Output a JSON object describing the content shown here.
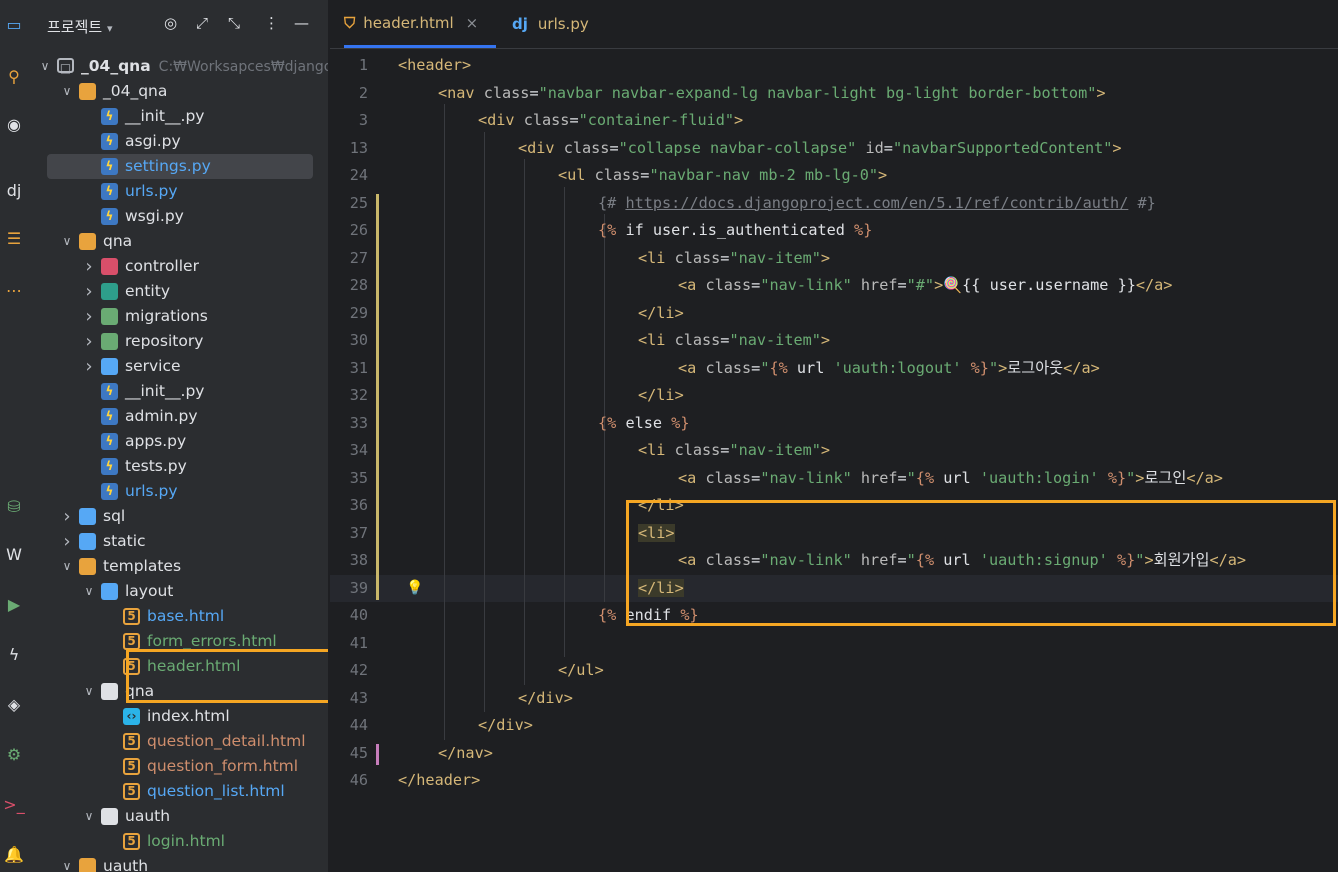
{
  "activity_bar": {
    "icons": [
      "monitor-icon",
      "commit-icon",
      "github-icon",
      "django-icon",
      "structure-icon",
      "more-icon",
      "database-icon",
      "word-icon",
      "run-icon",
      "python-icon",
      "layers-icon",
      "settings-icon",
      "terminal-icon",
      "notifications-icon"
    ]
  },
  "project_panel": {
    "title": "프로젝트",
    "tree": [
      {
        "label": "_04_qna",
        "hint": "C:₩Worksapces₩django",
        "kind": "root",
        "expanded": true,
        "depth": 0
      },
      {
        "label": "_04_qna",
        "kind": "folder",
        "expanded": true,
        "depth": 1
      },
      {
        "label": "__init__.py",
        "kind": "python",
        "depth": 2
      },
      {
        "label": "asgi.py",
        "kind": "python",
        "depth": 2
      },
      {
        "label": "settings.py",
        "kind": "python",
        "depth": 2,
        "selected": true,
        "color": "#56a8f5"
      },
      {
        "label": "urls.py",
        "kind": "python",
        "depth": 2,
        "color": "#56a8f5"
      },
      {
        "label": "wsgi.py",
        "kind": "python",
        "depth": 2
      },
      {
        "label": "qna",
        "kind": "folder",
        "expanded": true,
        "depth": 1
      },
      {
        "label": "controller",
        "kind": "pkg-controller",
        "expanded": false,
        "depth": 2
      },
      {
        "label": "entity",
        "kind": "pkg-entity",
        "expanded": false,
        "depth": 2
      },
      {
        "label": "migrations",
        "kind": "pkg-db",
        "expanded": false,
        "depth": 2
      },
      {
        "label": "repository",
        "kind": "pkg-db",
        "expanded": false,
        "depth": 2
      },
      {
        "label": "service",
        "kind": "pkg-service",
        "expanded": false,
        "depth": 2
      },
      {
        "label": "__init__.py",
        "kind": "python",
        "depth": 2
      },
      {
        "label": "admin.py",
        "kind": "python",
        "depth": 2
      },
      {
        "label": "apps.py",
        "kind": "python",
        "depth": 2
      },
      {
        "label": "tests.py",
        "kind": "python",
        "depth": 2
      },
      {
        "label": "urls.py",
        "kind": "python",
        "depth": 2,
        "color": "#56a8f5"
      },
      {
        "label": "sql",
        "kind": "folder-sql",
        "expanded": false,
        "depth": 1
      },
      {
        "label": "static",
        "kind": "folder-web",
        "expanded": false,
        "depth": 1
      },
      {
        "label": "templates",
        "kind": "folder-tpl",
        "expanded": true,
        "depth": 1
      },
      {
        "label": "layout",
        "kind": "folder-layout",
        "expanded": true,
        "depth": 2
      },
      {
        "label": "base.html",
        "kind": "html",
        "depth": 3,
        "color": "#56a8f5"
      },
      {
        "label": "form_errors.html",
        "kind": "html",
        "depth": 3,
        "color": "#6aab73"
      },
      {
        "label": "header.html",
        "kind": "html",
        "depth": 3,
        "color": "#6aab73"
      },
      {
        "label": "qna",
        "kind": "folder-plain",
        "expanded": true,
        "depth": 2
      },
      {
        "label": "index.html",
        "kind": "html-blue",
        "depth": 3
      },
      {
        "label": "question_detail.html",
        "kind": "html",
        "depth": 3,
        "color": "#cf8e6d"
      },
      {
        "label": "question_form.html",
        "kind": "html",
        "depth": 3,
        "color": "#cf8e6d"
      },
      {
        "label": "question_list.html",
        "kind": "html",
        "depth": 3,
        "color": "#56a8f5"
      },
      {
        "label": "uauth",
        "kind": "folder-plain",
        "expanded": true,
        "depth": 2
      },
      {
        "label": "login.html",
        "kind": "html",
        "depth": 3,
        "color": "#6aab73"
      },
      {
        "label": "uauth",
        "kind": "folder",
        "expanded": true,
        "depth": 1
      }
    ]
  },
  "tabs": [
    {
      "label": "header.html",
      "active": true,
      "icon": "html5-icon",
      "close": "×"
    },
    {
      "label": "urls.py",
      "active": false,
      "icon": "django-icon",
      "icon_text": "dj"
    }
  ],
  "editor": {
    "lines": [
      {
        "n": "1",
        "indent": 0,
        "segs": [
          [
            "tg",
            "<header>"
          ]
        ]
      },
      {
        "n": "2",
        "indent": 1,
        "segs": [
          [
            "tg",
            "<nav "
          ],
          [
            "at",
            "class"
          ],
          [
            "tx",
            "="
          ],
          [
            "av",
            "\"navbar navbar-expand-lg navbar-light bg-light border-bottom\""
          ],
          [
            "tg",
            ">"
          ]
        ]
      },
      {
        "n": "3",
        "indent": 2,
        "segs": [
          [
            "tg",
            "<div "
          ],
          [
            "at",
            "class"
          ],
          [
            "tx",
            "="
          ],
          [
            "av",
            "\"container-fluid\""
          ],
          [
            "tg",
            ">"
          ]
        ]
      },
      {
        "n": "13",
        "indent": 3,
        "segs": [
          [
            "tg",
            "<div "
          ],
          [
            "at",
            "class"
          ],
          [
            "tx",
            "="
          ],
          [
            "av",
            "\"collapse navbar-collapse\""
          ],
          [
            "tx",
            " "
          ],
          [
            "at",
            "id"
          ],
          [
            "tx",
            "="
          ],
          [
            "av",
            "\"navbarSupportedContent\""
          ],
          [
            "tg",
            ">"
          ]
        ]
      },
      {
        "n": "24",
        "indent": 4,
        "segs": [
          [
            "tg",
            "<ul "
          ],
          [
            "at",
            "class"
          ],
          [
            "tx",
            "="
          ],
          [
            "av",
            "\"navbar-nav mb-2 mb-lg-0\""
          ],
          [
            "tg",
            ">"
          ]
        ]
      },
      {
        "n": "25",
        "indent": 5,
        "segs": [
          [
            "cm",
            "{# https://docs.djangoproject.com/en/5.1/ref/contrib/auth/ #}"
          ]
        ]
      },
      {
        "n": "26",
        "indent": 5,
        "segs": [
          [
            "tp",
            "{%"
          ],
          [
            "tx",
            " if user.is_authenticated "
          ],
          [
            "tp",
            "%}"
          ]
        ]
      },
      {
        "n": "27",
        "indent": 6,
        "segs": [
          [
            "tg",
            "<li "
          ],
          [
            "at",
            "class"
          ],
          [
            "tx",
            "="
          ],
          [
            "av",
            "\"nav-item\""
          ],
          [
            "tg",
            ">"
          ]
        ]
      },
      {
        "n": "28",
        "indent": 7,
        "segs": [
          [
            "tg",
            "<a "
          ],
          [
            "at",
            "class"
          ],
          [
            "tx",
            "="
          ],
          [
            "av",
            "\"nav-link\""
          ],
          [
            "tx",
            " "
          ],
          [
            "at",
            "href"
          ],
          [
            "tx",
            "="
          ],
          [
            "av",
            "\"#\""
          ],
          [
            "tg",
            ">"
          ],
          [
            "tx",
            "🍭{{ user.username }}"
          ],
          [
            "tg",
            "</a>"
          ]
        ]
      },
      {
        "n": "29",
        "indent": 6,
        "segs": [
          [
            "tg",
            "</li>"
          ]
        ]
      },
      {
        "n": "30",
        "indent": 6,
        "segs": [
          [
            "tg",
            "<li "
          ],
          [
            "at",
            "class"
          ],
          [
            "tx",
            "="
          ],
          [
            "av",
            "\"nav-item\""
          ],
          [
            "tg",
            ">"
          ]
        ]
      },
      {
        "n": "31",
        "indent": 7,
        "segs": [
          [
            "tg",
            "<a "
          ],
          [
            "at",
            "class"
          ],
          [
            "tx",
            "="
          ],
          [
            "av",
            "\""
          ],
          [
            "tp",
            "{%"
          ],
          [
            "tx",
            " url "
          ],
          [
            "av",
            "'uauth:logout'"
          ],
          [
            "tx",
            " "
          ],
          [
            "tp",
            "%}"
          ],
          [
            "av",
            "\""
          ],
          [
            "tg",
            ">"
          ],
          [
            "tx",
            "로그아웃"
          ],
          [
            "tg",
            "</a>"
          ]
        ]
      },
      {
        "n": "32",
        "indent": 6,
        "segs": [
          [
            "tg",
            "</li>"
          ]
        ]
      },
      {
        "n": "33",
        "indent": 5,
        "segs": [
          [
            "tp",
            "{%"
          ],
          [
            "tx",
            " else "
          ],
          [
            "tp",
            "%}"
          ]
        ]
      },
      {
        "n": "34",
        "indent": 6,
        "segs": [
          [
            "tg",
            "<li "
          ],
          [
            "at",
            "class"
          ],
          [
            "tx",
            "="
          ],
          [
            "av",
            "\"nav-item\""
          ],
          [
            "tg",
            ">"
          ]
        ]
      },
      {
        "n": "35",
        "indent": 7,
        "segs": [
          [
            "tg",
            "<a "
          ],
          [
            "at",
            "class"
          ],
          [
            "tx",
            "="
          ],
          [
            "av",
            "\"nav-link\""
          ],
          [
            "tx",
            " "
          ],
          [
            "at",
            "href"
          ],
          [
            "tx",
            "="
          ],
          [
            "av",
            "\""
          ],
          [
            "tp",
            "{%"
          ],
          [
            "tx",
            " url "
          ],
          [
            "av",
            "'uauth:login'"
          ],
          [
            "tx",
            " "
          ],
          [
            "tp",
            "%}"
          ],
          [
            "av",
            "\""
          ],
          [
            "tg",
            ">"
          ],
          [
            "tx",
            "로그인"
          ],
          [
            "tg",
            "</a>"
          ]
        ]
      },
      {
        "n": "36",
        "indent": 6,
        "segs": [
          [
            "tg",
            "</li>"
          ]
        ]
      },
      {
        "n": "37",
        "indent": 6,
        "segs": [
          [
            "tgb",
            "<li>"
          ]
        ]
      },
      {
        "n": "38",
        "indent": 7,
        "segs": [
          [
            "tg",
            "<a "
          ],
          [
            "at",
            "class"
          ],
          [
            "tx",
            "="
          ],
          [
            "av",
            "\"nav-link\""
          ],
          [
            "tx",
            " "
          ],
          [
            "at",
            "href"
          ],
          [
            "tx",
            "="
          ],
          [
            "av",
            "\""
          ],
          [
            "tp",
            "{%"
          ],
          [
            "tx",
            " url "
          ],
          [
            "av",
            "'uauth:signup'"
          ],
          [
            "tx",
            " "
          ],
          [
            "tp",
            "%}"
          ],
          [
            "av",
            "\""
          ],
          [
            "tg",
            ">"
          ],
          [
            "tx",
            "회원가입"
          ],
          [
            "tg",
            "</a>"
          ]
        ]
      },
      {
        "n": "39",
        "indent": 6,
        "segs": [
          [
            "tgb",
            "</li>"
          ]
        ],
        "current": true
      },
      {
        "n": "40",
        "indent": 5,
        "segs": [
          [
            "tp",
            "{%"
          ],
          [
            "tx",
            " endif "
          ],
          [
            "tp",
            "%}"
          ]
        ]
      },
      {
        "n": "41",
        "indent": 0,
        "segs": []
      },
      {
        "n": "42",
        "indent": 4,
        "segs": [
          [
            "tg",
            "</ul>"
          ]
        ]
      },
      {
        "n": "43",
        "indent": 3,
        "segs": [
          [
            "tg",
            "</div>"
          ]
        ]
      },
      {
        "n": "44",
        "indent": 2,
        "segs": [
          [
            "tg",
            "</div>"
          ]
        ]
      },
      {
        "n": "45",
        "indent": 1,
        "segs": [
          [
            "tg",
            "</nav>"
          ]
        ]
      },
      {
        "n": "46",
        "indent": 0,
        "segs": [
          [
            "tg",
            "</header>"
          ]
        ]
      }
    ]
  }
}
